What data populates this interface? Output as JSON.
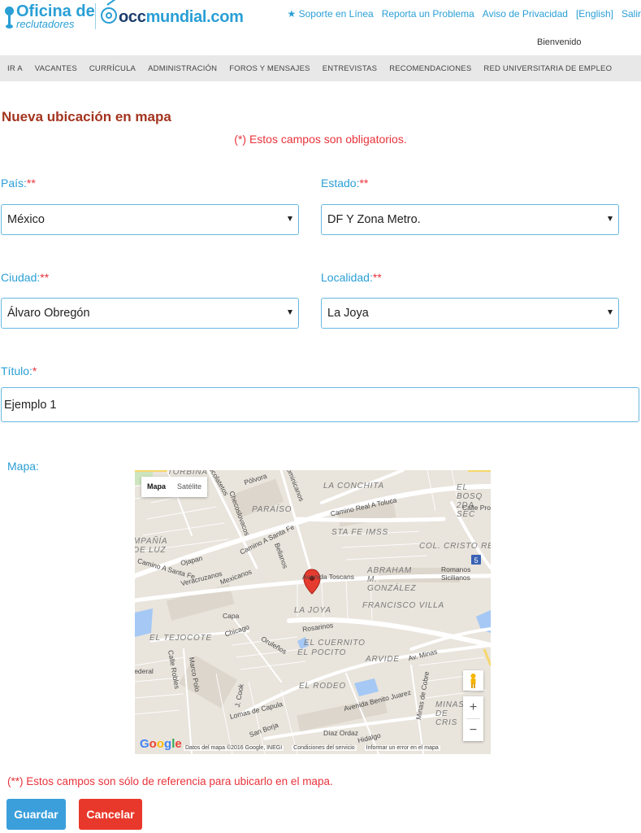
{
  "header": {
    "logo_brand": "Oficina de",
    "logo_sub": "reclutadores",
    "logo_site_prefix": "occ",
    "logo_site_suffix": "mundial.com",
    "links": [
      "Soporte en Línea",
      "Reporta un Problema",
      "Aviso de Privacidad",
      "[English]",
      "Salir"
    ],
    "welcome": "Bienvenido"
  },
  "nav": {
    "items": [
      "IR A",
      "VACANTES",
      "CURRÍCULA",
      "ADMINISTRACIÓN",
      "FOROS Y MENSAJES",
      "ENTREVISTAS",
      "RECOMENDACIONES",
      "RED UNIVERSITARIA DE EMPLEO"
    ]
  },
  "page": {
    "title": "Nueva ubicación en mapa",
    "required_note": "(*) Estos campos son obligatorios."
  },
  "form": {
    "pais": {
      "label": "País:",
      "marker": "**",
      "value": "México"
    },
    "estado": {
      "label": "Estado:",
      "marker": "**",
      "value": "DF Y Zona Metro."
    },
    "ciudad": {
      "label": "Ciudad:",
      "marker": "**",
      "value": "Álvaro Obregón"
    },
    "localidad": {
      "label": "Localidad:",
      "marker": "**",
      "value": "La Joya"
    },
    "titulo": {
      "label": "Título:",
      "marker": "*",
      "value": "Ejemplo 1"
    },
    "mapa": {
      "label": "Mapa:"
    }
  },
  "map": {
    "toggle_map": "Mapa",
    "toggle_satellite": "Satélite",
    "zoom_in": "+",
    "zoom_out": "−",
    "attribution_data": "Datos del mapa ©2016 Google, INEGI",
    "attribution_terms": "Condiciones del servicio",
    "attribution_report": "Informar un error en el mapa",
    "neighborhoods": [
      "TORBINA",
      "PARAÍSO",
      "LA CONCHITA",
      "STA FE IMSS",
      "COL. CRISTO RE",
      "ABRAHAM M. GONZÁLEZ",
      "LA JOYA",
      "FRANCISCO VILLA",
      "EL TEJOCOTE",
      "EL CUERNITO",
      "EL POCITO",
      "ARVIDE",
      "EL RODEO",
      "EL BOSQ 2DA SEC",
      "MINAS DE CRIS",
      "MPAÑÍA DE LUZ"
    ],
    "streets": [
      "Pólvora",
      "Dominicanos",
      "Chocolatetos",
      "Checoslovacos",
      "Camino Real A Toluca",
      "Calle Pro",
      "Camino A Santa Fe",
      "Belianos",
      "Ojapan",
      "Veracruzanos",
      "Mexicanos",
      "Avenida Toscans",
      "Romanos",
      "Sicilianos",
      "Capa",
      "Chicago",
      "Rosarinos",
      "Oruleños",
      "Av. Minas",
      "Calle Robles",
      "Marco Polo",
      "J. Cook",
      "Lomas de Capula",
      "San Borja",
      "Avenida Benito Juarez",
      "Minas de Cobre",
      "Díaz Ordaz",
      "Hidalgo",
      "Federal",
      "Camino A Santa Fe"
    ],
    "highway_shield": "5"
  },
  "footer": {
    "note": "(**) Estos campos son sólo de referencia para ubicarlo en el mapa.",
    "save": "Guardar",
    "cancel": "Cancelar"
  },
  "colors": {
    "link_blue": "#2a9fd6",
    "title_red": "#a3341f",
    "required_red": "#e8333b",
    "save_blue": "#3a9fdb",
    "cancel_red": "#e8382b"
  }
}
